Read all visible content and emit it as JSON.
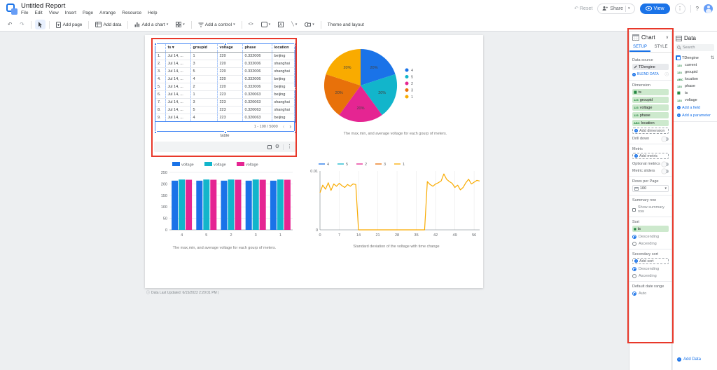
{
  "app": {
    "title": "Untitled Report"
  },
  "menubar": {
    "items": [
      "File",
      "Edit",
      "View",
      "Insert",
      "Page",
      "Arrange",
      "Resource",
      "Help"
    ]
  },
  "toolbar": {
    "add_page": "Add page",
    "add_data": "Add data",
    "add_chart": "Add a chart",
    "add_control": "Add a control",
    "theme_layout": "Theme and layout"
  },
  "header_actions": {
    "reset": "Reset",
    "share": "Share",
    "view": "View"
  },
  "icons": {
    "undo": "↶",
    "redo": "↷",
    "caret": "▾",
    "chevron_down": "∨",
    "more_vertical": "⋮",
    "help": "?",
    "embed": "<>",
    "line": "╲",
    "page_prev": "‹",
    "page_next": "›",
    "info": "ⓘ",
    "gear": "⚙",
    "number_type": "123",
    "text_type": "ABC",
    "date_type": "▦",
    "plus": "+"
  },
  "canvas": {
    "last_updated": "Data Last Updated: 6/15/2022 2:20:01 PM |"
  },
  "chart_data": [
    {
      "type": "table",
      "caption": "table",
      "columns": [
        "ts",
        "groupid",
        "voltage",
        "phase",
        "location"
      ],
      "sort_column": "ts",
      "rows": [
        [
          "1.",
          "Jul 14, ...",
          "1",
          "220",
          "0.332006",
          "beijing"
        ],
        [
          "2.",
          "Jul 14, ...",
          "3",
          "220",
          "0.332006",
          "shanghai"
        ],
        [
          "3.",
          "Jul 14, ...",
          "5",
          "220",
          "0.332006",
          "shanghai"
        ],
        [
          "4.",
          "Jul 14, ...",
          "4",
          "220",
          "0.332006",
          "beijing"
        ],
        [
          "5.",
          "Jul 14, ...",
          "2",
          "220",
          "0.332006",
          "beijing"
        ],
        [
          "6.",
          "Jul 14, ...",
          "1",
          "223",
          "0.320063",
          "beijing"
        ],
        [
          "7.",
          "Jul 14, ...",
          "3",
          "223",
          "0.320063",
          "shanghai"
        ],
        [
          "8.",
          "Jul 14, ...",
          "5",
          "223",
          "0.320063",
          "shanghai"
        ],
        [
          "9.",
          "Jul 14, ...",
          "4",
          "223",
          "0.320063",
          "beijing"
        ]
      ],
      "pagination": "1 - 100 / 5000"
    },
    {
      "type": "pie",
      "title": "The max,min, and average voltage for each gourp of meters.",
      "labels": [
        "4",
        "5",
        "2",
        "3",
        "1"
      ],
      "values": [
        20,
        20,
        20,
        20,
        20
      ],
      "value_labels": [
        "20%",
        "20%",
        "20%",
        "20%",
        "20%"
      ],
      "colors": [
        "#1a73e8",
        "#12b5cb",
        "#e52592",
        "#e8710a",
        "#f9ab00"
      ],
      "legend_position": "right"
    },
    {
      "type": "bar",
      "title": "The max,min, and average voltage for each gourp of meters.",
      "categories": [
        "4",
        "5",
        "2",
        "3",
        "1"
      ],
      "series": [
        {
          "name": "voltage",
          "color": "#1a73e8",
          "values": [
            214,
            214,
            214,
            214,
            214
          ]
        },
        {
          "name": "voltage",
          "color": "#12b5cb",
          "values": [
            219,
            219,
            219,
            219,
            219
          ]
        },
        {
          "name": "voltage",
          "color": "#e52592",
          "values": [
            218,
            218,
            218,
            218,
            218
          ]
        }
      ],
      "ylim": [
        0,
        250
      ],
      "yticks": [
        0,
        50,
        100,
        150,
        200,
        250
      ],
      "grid": true,
      "legend_position": "top"
    },
    {
      "type": "line",
      "title": "Standard deviation of the voltage with time change",
      "legend": [
        {
          "name": "4",
          "color": "#1a73e8"
        },
        {
          "name": "5",
          "color": "#12b5cb"
        },
        {
          "name": "2",
          "color": "#e52592"
        },
        {
          "name": "3",
          "color": "#e8710a"
        },
        {
          "name": "1",
          "color": "#f9ab00"
        }
      ],
      "ylim": [
        0,
        0.01
      ],
      "ytick_labels": [
        "0",
        "0.01"
      ],
      "xticks": [
        0,
        7,
        14,
        21,
        28,
        35,
        42,
        49,
        56
      ],
      "xmax": 58,
      "grid": true,
      "visible_series": {
        "name": "1",
        "color": "#f9ab00",
        "x_step": 1,
        "values": [
          0.0063,
          0.0076,
          0.0069,
          0.008,
          0.0067,
          0.0078,
          0.0074,
          0.0079,
          0.0075,
          0.0072,
          0.0077,
          0.0074,
          0.0078,
          0.0077,
          0,
          0,
          0,
          0,
          0,
          0,
          0,
          0,
          0,
          0,
          0,
          0,
          0,
          0,
          0,
          0,
          0,
          0,
          0,
          0,
          0,
          0,
          0,
          0,
          0,
          0.0082,
          0.0077,
          0.0074,
          0.0078,
          0.008,
          0.0083,
          0.0095,
          0.0086,
          0.0082,
          0.0079,
          0.0072,
          0.0076,
          0.0068,
          0.0072,
          0.008,
          0.0086,
          0.0078,
          0.0081,
          0.0084,
          0.0083
        ]
      }
    }
  ],
  "properties_panel": {
    "title": "Chart",
    "tabs": [
      "SETUP",
      "STYLE"
    ],
    "active_tab": "SETUP",
    "data_source": {
      "label": "Data source",
      "name": "TDengine",
      "blend": "BLEND DATA"
    },
    "dimension": {
      "label": "Dimension",
      "fields": [
        {
          "type": "date",
          "name": "ts"
        },
        {
          "type": "number",
          "name": "groupid"
        },
        {
          "type": "number",
          "name": "voltage"
        },
        {
          "type": "number",
          "name": "phase"
        },
        {
          "type": "text",
          "name": "location"
        }
      ],
      "add": "Add dimension"
    },
    "drill_down": {
      "label": "Drill down",
      "on": false
    },
    "metric": {
      "label": "Metric",
      "add": "Add metric",
      "optional": "Optional metrics",
      "sliders": "Metric sliders"
    },
    "rows_per_page": {
      "label": "Rows per Page",
      "value": "100"
    },
    "summary": {
      "label": "Summary row",
      "checkbox": "Show summary row",
      "checked": false
    },
    "sort": {
      "label": "Sort",
      "field": {
        "type": "date",
        "name": "ts"
      },
      "options": [
        "Descending",
        "Ascending"
      ],
      "selected": "Descending"
    },
    "secondary_sort": {
      "label": "Secondary sort",
      "add": "Add sort",
      "options": [
        "Descending",
        "Ascending"
      ],
      "selected": "Descending"
    },
    "default_date_range": {
      "label": "Default date range",
      "options": [
        "Auto"
      ],
      "selected": "Auto"
    }
  },
  "data_panel": {
    "title": "Data",
    "search_placeholder": "Search",
    "source": "TDengine",
    "fields": [
      {
        "type": "number",
        "name": "current"
      },
      {
        "type": "number",
        "name": "groupid"
      },
      {
        "type": "text",
        "name": "location"
      },
      {
        "type": "number",
        "name": "phase"
      },
      {
        "type": "date",
        "name": "ts"
      },
      {
        "type": "number",
        "name": "voltage"
      }
    ],
    "add_field": "Add a field",
    "add_parameter": "Add a parameter",
    "add_data": "Add Data"
  },
  "colors": {
    "accent": "#1a73e8",
    "annotation": "#e8382a",
    "chip_green": "#cde9cd",
    "field_icon_green": "#188038",
    "canvas_bg": "#edeff1",
    "palette": [
      "#1a73e8",
      "#12b5cb",
      "#e52592",
      "#e8710a",
      "#f9ab00"
    ]
  }
}
